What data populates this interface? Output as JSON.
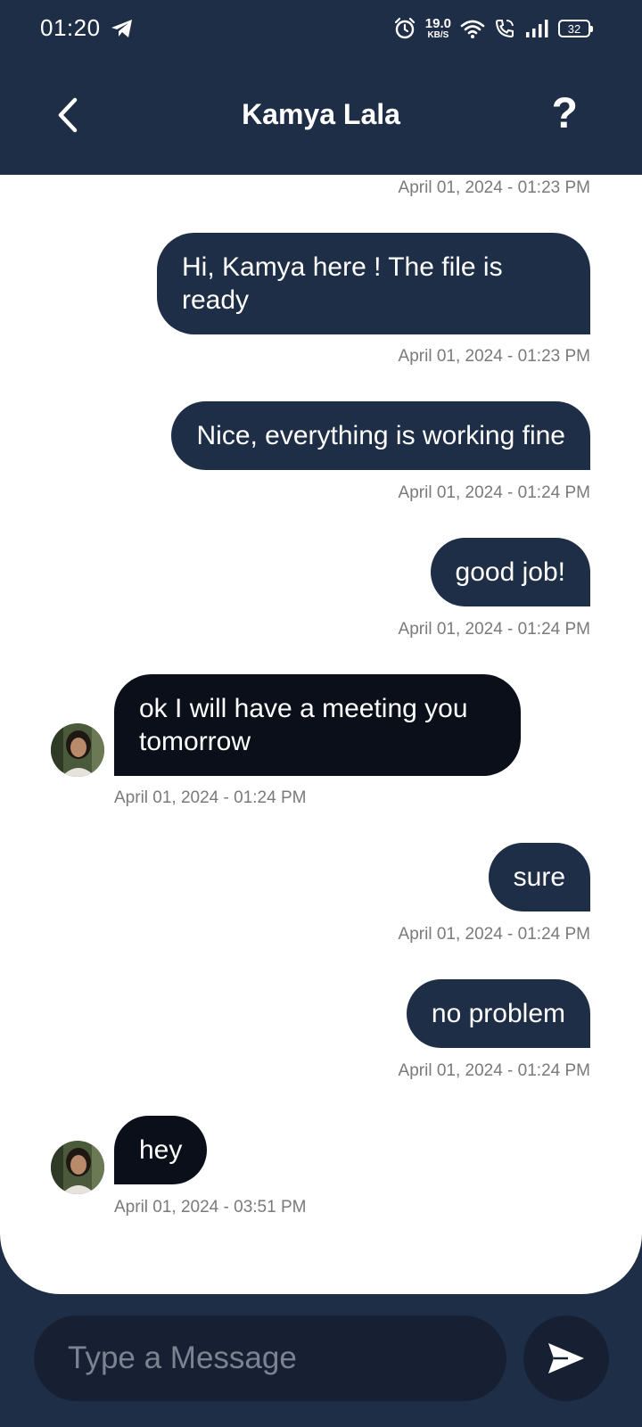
{
  "status_bar": {
    "time": "01:20",
    "net_speed": "19.0",
    "net_unit": "KB/S",
    "battery": "32"
  },
  "header": {
    "title": "Kamya Lala",
    "help_label": "?"
  },
  "messages": [
    {
      "type": "timestamp_only",
      "timestamp": "April 01, 2024 - 01:23 PM"
    },
    {
      "direction": "sent",
      "text": "Hi, Kamya here ! The file is ready",
      "timestamp": "April 01, 2024 - 01:23 PM"
    },
    {
      "direction": "sent",
      "text": "Nice, everything is working fine",
      "timestamp": "April 01, 2024 - 01:24 PM"
    },
    {
      "direction": "sent",
      "text": "good job!",
      "timestamp": "April 01, 2024 - 01:24 PM"
    },
    {
      "direction": "received",
      "text": "ok I will have a meeting you tomorrow",
      "timestamp": "April 01, 2024 - 01:24 PM"
    },
    {
      "direction": "sent",
      "text": "sure",
      "timestamp": "April 01, 2024 - 01:24 PM"
    },
    {
      "direction": "sent",
      "text": "no problem",
      "timestamp": "April 01, 2024 - 01:24 PM"
    },
    {
      "direction": "received",
      "text": "hey",
      "timestamp": "April 01, 2024 - 03:51 PM"
    }
  ],
  "composer": {
    "placeholder": "Type a Message",
    "value": ""
  },
  "icons": {
    "back": "chevron-left-icon",
    "send": "send-icon",
    "avatar": "contact-avatar"
  },
  "colors": {
    "header_bg": "#1f2e47",
    "sent_bubble": "#1f2e47",
    "received_bubble": "#0a0f1a",
    "chat_bg": "#ffffff",
    "timestamp": "#7a7a7a",
    "input_bg": "#172033"
  }
}
